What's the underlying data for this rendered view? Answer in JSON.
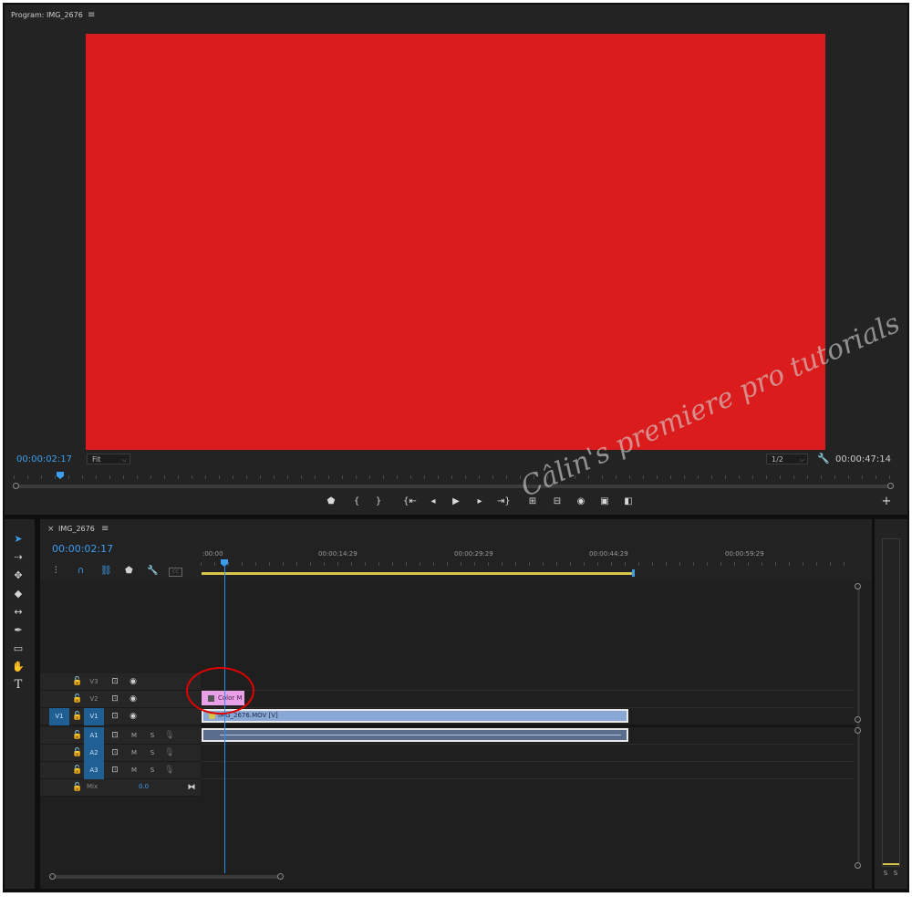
{
  "program": {
    "title": "Program: IMG_2676",
    "timecode": "00:00:02:17",
    "fit_label": "Fit",
    "resolution_label": "1/2",
    "duration": "00:00:47:14",
    "video_color": "#da1c1c"
  },
  "transport": {
    "icons": [
      "marker-icon",
      "mark-in-icon",
      "mark-out-icon",
      "go-to-in-icon",
      "step-back-icon",
      "play-icon",
      "step-forward-icon",
      "go-to-out-icon",
      "insert-icon",
      "overwrite-icon",
      "export-frame-icon",
      "comparison-view-icon",
      "trim-icon",
      "add-button-icon"
    ]
  },
  "timeline": {
    "sequence_tab": "IMG_2676",
    "timecode": "00:00:02:17",
    "ruler_labels": [
      ":00:00",
      "00:00:14:29",
      "00:00:29:29",
      "00:00:44:29",
      "00:00:59:29"
    ],
    "video_tracks": [
      {
        "name": "V3"
      },
      {
        "name": "V2"
      },
      {
        "name": "V1",
        "source": "V1"
      }
    ],
    "audio_tracks": [
      {
        "name": "A1",
        "m": "M",
        "s": "S"
      },
      {
        "name": "A2",
        "m": "M",
        "s": "S"
      },
      {
        "name": "A3",
        "m": "M",
        "s": "S"
      }
    ],
    "mix": {
      "label": "Mix",
      "value": "0.0"
    },
    "clips": {
      "color_matte": "Color M",
      "video": "IMG_2676.MOV [V]"
    }
  },
  "meters": {
    "solo_labels": [
      "S",
      "S"
    ]
  },
  "watermark": "Câlin's premiere pro tutorials",
  "colors": {
    "accent_blue": "#2e8ef0",
    "clip_video": "#8aa7d6",
    "clip_matte": "#e8a1e6",
    "work_area": "#d9c54a",
    "highlight_circle": "#e00000"
  }
}
